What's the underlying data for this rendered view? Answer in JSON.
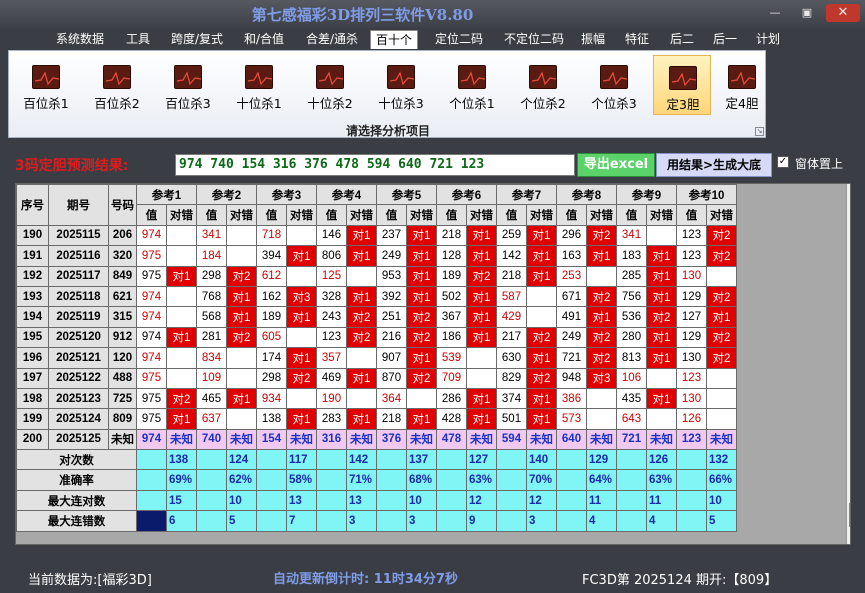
{
  "app": {
    "title": "第七感福彩3D排列三软件V8.80"
  },
  "window_controls": {
    "min": "—",
    "max": "▣",
    "close": "✕"
  },
  "menu": [
    {
      "label": "系统数据",
      "active": false
    },
    {
      "label": "工具",
      "active": false
    },
    {
      "label": "跨度/复式",
      "active": false
    },
    {
      "label": "和/合值",
      "active": false
    },
    {
      "label": "合差/通杀",
      "active": false
    },
    {
      "label": "百十个",
      "active": true
    },
    {
      "label": "定位二码",
      "active": false
    },
    {
      "label": "不定位二码",
      "active": false
    },
    {
      "label": "振幅",
      "active": false
    },
    {
      "label": "特征",
      "active": false
    },
    {
      "label": "后二",
      "active": false
    },
    {
      "label": "后一",
      "active": false
    },
    {
      "label": "计划",
      "active": false
    }
  ],
  "ribbon": {
    "buttons": [
      {
        "label": "百位杀1",
        "active": false
      },
      {
        "label": "百位杀2",
        "active": false
      },
      {
        "label": "百位杀3",
        "active": false
      },
      {
        "label": "十位杀1",
        "active": false
      },
      {
        "label": "十位杀2",
        "active": false
      },
      {
        "label": "十位杀3",
        "active": false
      },
      {
        "label": "个位杀1",
        "active": false
      },
      {
        "label": "个位杀2",
        "active": false
      },
      {
        "label": "个位杀3",
        "active": false
      },
      {
        "label": "定3胆",
        "active": true
      },
      {
        "label": "定4胆",
        "active": false
      }
    ],
    "caption": "请选择分析项目",
    "launcher": "↘"
  },
  "result": {
    "label": "3码定胆预测结果:",
    "value": "974 740 154 316 376 478 594 640 721 123",
    "export_label": "导出excel",
    "generate_label": "用结果>生成大底",
    "ontop_checked": "✓",
    "ontop_label": "窗体置上"
  },
  "table": {
    "headers": {
      "seq": "序号",
      "issue": "期号",
      "number": "号码",
      "value": "值",
      "check": "对错"
    },
    "refs": [
      "参考1",
      "参考2",
      "参考3",
      "参考4",
      "参考5",
      "参考6",
      "参考7",
      "参考8",
      "参考9",
      "参考10"
    ],
    "rows": [
      {
        "seq": "190",
        "issue": "2025115",
        "num": "206",
        "cells": [
          [
            "974",
            "",
            "r"
          ],
          [
            "341",
            "",
            "r"
          ],
          [
            "718",
            "",
            "r"
          ],
          [
            "146",
            "对1",
            "h"
          ],
          [
            "237",
            "对1",
            "h"
          ],
          [
            "218",
            "对1",
            "h"
          ],
          [
            "259",
            "对1",
            "h"
          ],
          [
            "296",
            "对2",
            "h"
          ],
          [
            "341",
            "",
            "r"
          ],
          [
            "123",
            "对2",
            "h"
          ]
        ]
      },
      {
        "seq": "191",
        "issue": "2025116",
        "num": "320",
        "cells": [
          [
            "975",
            "",
            "r"
          ],
          [
            "184",
            "",
            "r"
          ],
          [
            "394",
            "对1",
            "h"
          ],
          [
            "806",
            "对1",
            "h"
          ],
          [
            "249",
            "对1",
            "h"
          ],
          [
            "128",
            "对1",
            "h"
          ],
          [
            "142",
            "对1",
            "h"
          ],
          [
            "163",
            "对1",
            "h"
          ],
          [
            "183",
            "对1",
            "h"
          ],
          [
            "123",
            "对2",
            "h"
          ]
        ]
      },
      {
        "seq": "192",
        "issue": "2025117",
        "num": "849",
        "cells": [
          [
            "975",
            "对1",
            "h"
          ],
          [
            "298",
            "对2",
            "h"
          ],
          [
            "612",
            "",
            "r"
          ],
          [
            "125",
            "",
            "r"
          ],
          [
            "953",
            "对1",
            "h"
          ],
          [
            "189",
            "对2",
            "h"
          ],
          [
            "218",
            "对1",
            "h"
          ],
          [
            "253",
            "",
            "r"
          ],
          [
            "285",
            "对1",
            "h"
          ],
          [
            "130",
            "",
            "r"
          ]
        ]
      },
      {
        "seq": "193",
        "issue": "2025118",
        "num": "621",
        "cells": [
          [
            "974",
            "",
            "r"
          ],
          [
            "768",
            "对1",
            "h"
          ],
          [
            "162",
            "对3",
            "h"
          ],
          [
            "328",
            "对1",
            "h"
          ],
          [
            "392",
            "对1",
            "h"
          ],
          [
            "502",
            "对1",
            "h"
          ],
          [
            "587",
            "",
            "r"
          ],
          [
            "671",
            "对2",
            "h"
          ],
          [
            "756",
            "对1",
            "h"
          ],
          [
            "129",
            "对2",
            "h"
          ]
        ]
      },
      {
        "seq": "194",
        "issue": "2025119",
        "num": "315",
        "cells": [
          [
            "974",
            "",
            "r"
          ],
          [
            "568",
            "对1",
            "h"
          ],
          [
            "189",
            "对1",
            "h"
          ],
          [
            "243",
            "对2",
            "h"
          ],
          [
            "251",
            "对2",
            "h"
          ],
          [
            "367",
            "对1",
            "h"
          ],
          [
            "429",
            "",
            "r"
          ],
          [
            "491",
            "对1",
            "h"
          ],
          [
            "536",
            "对2",
            "h"
          ],
          [
            "127",
            "对1",
            "h"
          ]
        ]
      },
      {
        "seq": "195",
        "issue": "2025120",
        "num": "912",
        "cells": [
          [
            "974",
            "对1",
            "h"
          ],
          [
            "281",
            "对2",
            "h"
          ],
          [
            "605",
            "",
            "r"
          ],
          [
            "123",
            "对2",
            "h"
          ],
          [
            "216",
            "对2",
            "h"
          ],
          [
            "186",
            "对1",
            "h"
          ],
          [
            "217",
            "对2",
            "h"
          ],
          [
            "249",
            "对2",
            "h"
          ],
          [
            "280",
            "对1",
            "h"
          ],
          [
            "129",
            "对2",
            "h"
          ]
        ]
      },
      {
        "seq": "196",
        "issue": "2025121",
        "num": "120",
        "cells": [
          [
            "974",
            "",
            "r"
          ],
          [
            "834",
            "",
            "r"
          ],
          [
            "174",
            "对1",
            "h"
          ],
          [
            "357",
            "",
            "r"
          ],
          [
            "907",
            "对1",
            "h"
          ],
          [
            "539",
            "",
            "r"
          ],
          [
            "630",
            "对1",
            "h"
          ],
          [
            "721",
            "对2",
            "h"
          ],
          [
            "813",
            "对1",
            "h"
          ],
          [
            "130",
            "对2",
            "h"
          ]
        ]
      },
      {
        "seq": "197",
        "issue": "2025122",
        "num": "488",
        "cells": [
          [
            "975",
            "",
            "r"
          ],
          [
            "109",
            "",
            "r"
          ],
          [
            "298",
            "对2",
            "h"
          ],
          [
            "469",
            "对1",
            "h"
          ],
          [
            "870",
            "对2",
            "h"
          ],
          [
            "709",
            "",
            "r"
          ],
          [
            "829",
            "对2",
            "h"
          ],
          [
            "948",
            "对3",
            "h"
          ],
          [
            "106",
            "",
            "r"
          ],
          [
            "123",
            "",
            "r"
          ]
        ]
      },
      {
        "seq": "198",
        "issue": "2025123",
        "num": "725",
        "cells": [
          [
            "975",
            "对2",
            "h"
          ],
          [
            "465",
            "对1",
            "h"
          ],
          [
            "934",
            "",
            "r"
          ],
          [
            "190",
            "",
            "r"
          ],
          [
            "364",
            "",
            "r"
          ],
          [
            "286",
            "对1",
            "h"
          ],
          [
            "374",
            "对1",
            "h"
          ],
          [
            "386",
            "",
            "r"
          ],
          [
            "435",
            "对1",
            "h"
          ],
          [
            "130",
            "",
            "r"
          ]
        ]
      },
      {
        "seq": "199",
        "issue": "2025124",
        "num": "809",
        "cells": [
          [
            "975",
            "对1",
            "h"
          ],
          [
            "637",
            "",
            "r"
          ],
          [
            "138",
            "对1",
            "h"
          ],
          [
            "283",
            "对1",
            "h"
          ],
          [
            "218",
            "对1",
            "h"
          ],
          [
            "428",
            "对1",
            "h"
          ],
          [
            "501",
            "对1",
            "h"
          ],
          [
            "573",
            "",
            "r"
          ],
          [
            "643",
            "",
            "r"
          ],
          [
            "126",
            "",
            "r"
          ]
        ]
      }
    ],
    "prediction": {
      "seq": "200",
      "issue": "2025125",
      "num": "未知",
      "cells": [
        [
          "974",
          "未知"
        ],
        [
          "740",
          "未知"
        ],
        [
          "154",
          "未知"
        ],
        [
          "316",
          "未知"
        ],
        [
          "376",
          "未知"
        ],
        [
          "478",
          "未知"
        ],
        [
          "594",
          "未知"
        ],
        [
          "640",
          "未知"
        ],
        [
          "721",
          "未知"
        ],
        [
          "123",
          "未知"
        ]
      ]
    },
    "stats": [
      {
        "label": "对次数",
        "values": [
          "138",
          "124",
          "117",
          "142",
          "137",
          "127",
          "140",
          "129",
          "126",
          "132"
        ]
      },
      {
        "label": "准确率",
        "values": [
          "69%",
          "62%",
          "58%",
          "71%",
          "68%",
          "63%",
          "70%",
          "64%",
          "63%",
          "66%"
        ]
      },
      {
        "label": "最大连对数",
        "values": [
          "15",
          "10",
          "13",
          "13",
          "10",
          "12",
          "12",
          "11",
          "11",
          "10"
        ]
      },
      {
        "label": "最大连错数",
        "values": [
          "6",
          "5",
          "7",
          "3",
          "3",
          "9",
          "3",
          "4",
          "4",
          "5"
        ]
      }
    ]
  },
  "status": {
    "source": "当前数据为:[福彩3D]",
    "countdown": "自动更新倒计时: 11时34分7秒",
    "issue": "FC3D第 2025124 期开:【809】"
  },
  "colors": {
    "hit": "#e00000",
    "value_red": "#d10000",
    "stats_bg": "#7ff5f5",
    "predict_bg": "#f0c8f0",
    "title": "#7f9ce8"
  }
}
